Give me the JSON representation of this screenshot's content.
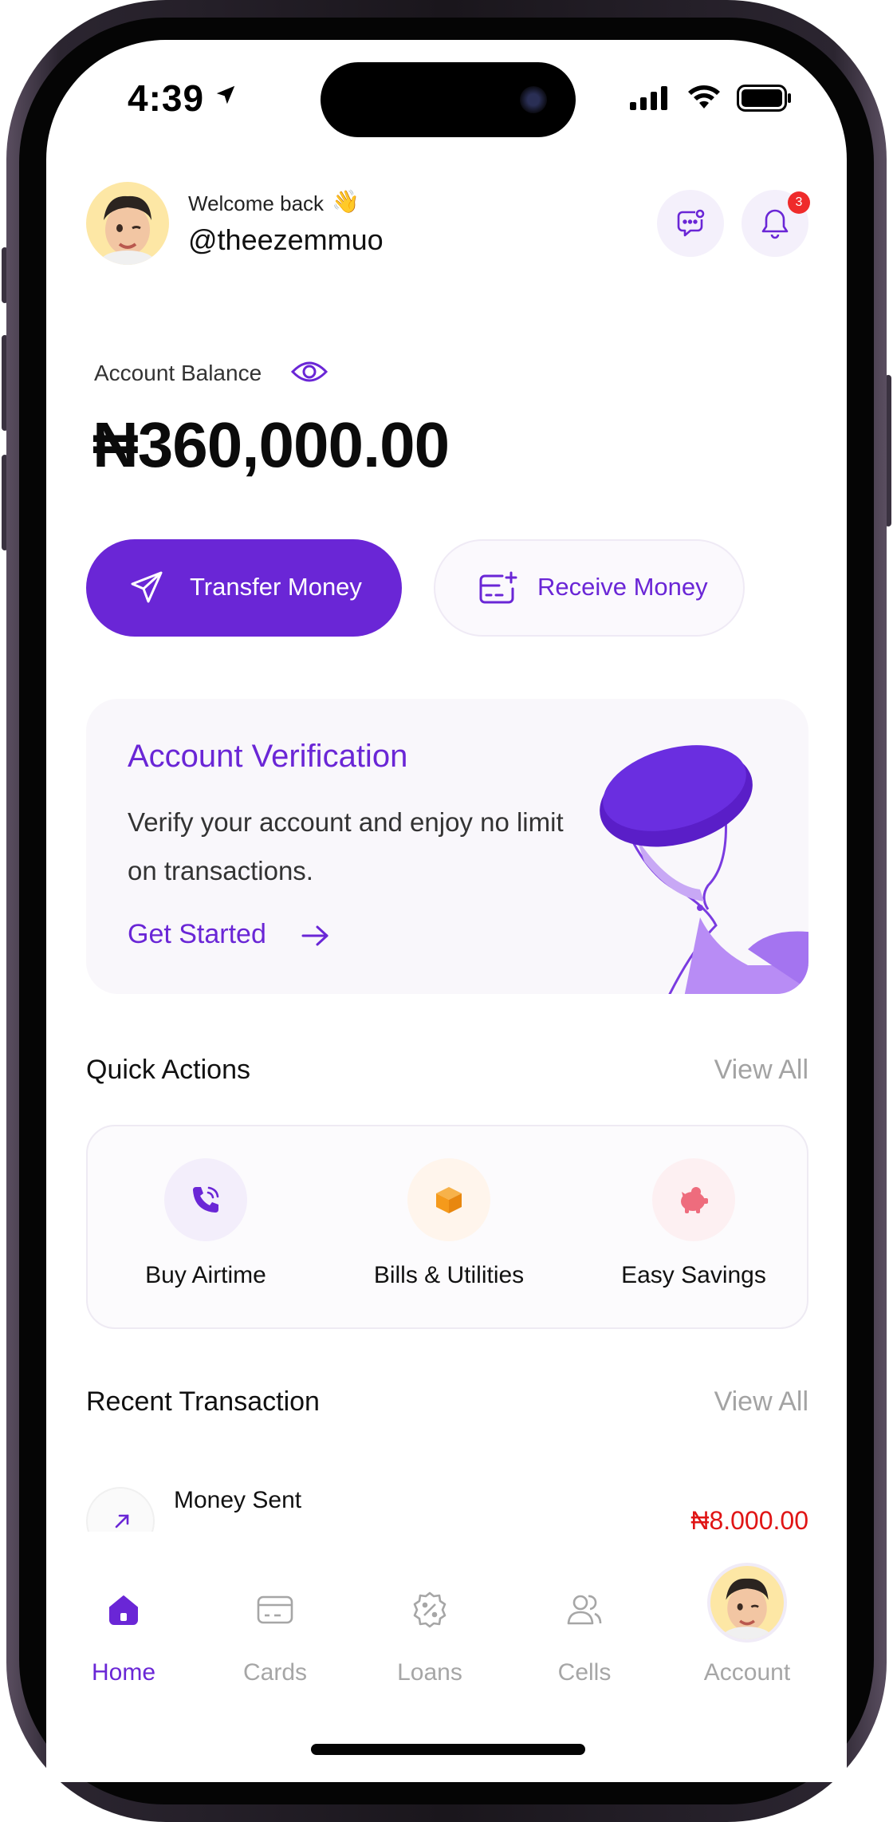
{
  "status_bar": {
    "time": "4:39"
  },
  "header": {
    "welcome": "Welcome back",
    "wave_emoji": "👋",
    "username": "@theezemmuo",
    "notification_count": "3"
  },
  "balance": {
    "label": "Account Balance",
    "amount": "₦360,000.00"
  },
  "actions": {
    "transfer_label": "Transfer Money",
    "receive_label": "Receive Money"
  },
  "verification": {
    "title": "Account Verification",
    "text": "Verify your account and enjoy no limit on transactions.",
    "cta": "Get Started"
  },
  "quick_actions": {
    "title": "Quick Actions",
    "view_all": "View All",
    "items": [
      {
        "label": "Buy Airtime",
        "icon": "phone-call-icon",
        "bg": "#f3eefb",
        "color": "#6a26d6"
      },
      {
        "label": "Bills & Utilities",
        "icon": "box-icon",
        "bg": "#fff5ec",
        "color": "#f59a1b"
      },
      {
        "label": "Easy Savings",
        "icon": "piggy-bank-icon",
        "bg": "#fdf0f2",
        "color": "#ee6c7d"
      }
    ]
  },
  "recent": {
    "title": "Recent Transaction",
    "view_all": "View All",
    "items": [
      {
        "title": "Money Sent",
        "amount": "₦8.000.00"
      }
    ]
  },
  "nav": {
    "items": [
      {
        "label": "Home",
        "icon": "home-icon",
        "active": true
      },
      {
        "label": "Cards",
        "icon": "card-icon",
        "active": false
      },
      {
        "label": "Loans",
        "icon": "loan-badge-icon",
        "active": false
      },
      {
        "label": "Cells",
        "icon": "users-icon",
        "active": false
      },
      {
        "label": "Account",
        "icon": "avatar",
        "active": false
      }
    ]
  },
  "colors": {
    "primary": "#6a26d6",
    "negative": "#e01515",
    "muted": "#a3a3a3"
  }
}
